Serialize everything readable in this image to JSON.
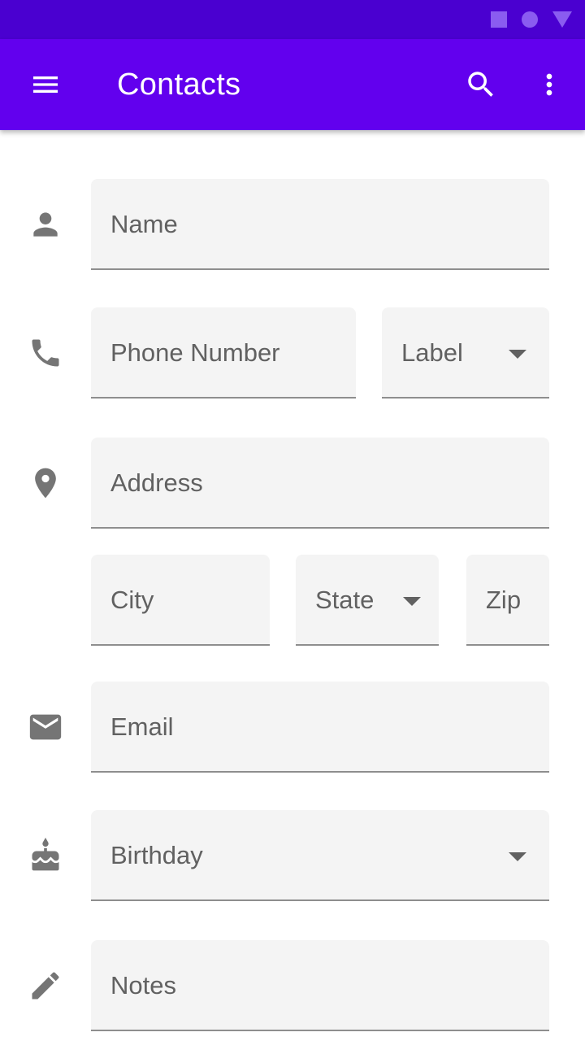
{
  "status_bar": {
    "icons": [
      "square-icon",
      "circle-icon",
      "triangle-icon"
    ]
  },
  "app_bar": {
    "title": "Contacts",
    "icons": [
      "menu-icon",
      "search-icon",
      "more-vert-icon"
    ],
    "color": "#6200ee"
  },
  "form": {
    "name": {
      "label": "Name",
      "icon": "person-icon"
    },
    "phone": {
      "label": "Phone Number",
      "icon": "phone-icon"
    },
    "phone_label": {
      "label": "Label"
    },
    "address": {
      "label": "Address",
      "icon": "location-pin-icon"
    },
    "city": {
      "label": "City"
    },
    "state": {
      "label": "State"
    },
    "zip": {
      "label": "Zip"
    },
    "email": {
      "label": "Email",
      "icon": "email-icon"
    },
    "birthday": {
      "label": "Birthday",
      "icon": "cake-icon"
    },
    "notes": {
      "label": "Notes",
      "icon": "pencil-icon"
    }
  },
  "colors": {
    "status_bar": "#4a00d0",
    "field_background": "#f4f4f4",
    "icon": "#757575",
    "label_text": "#616161"
  }
}
